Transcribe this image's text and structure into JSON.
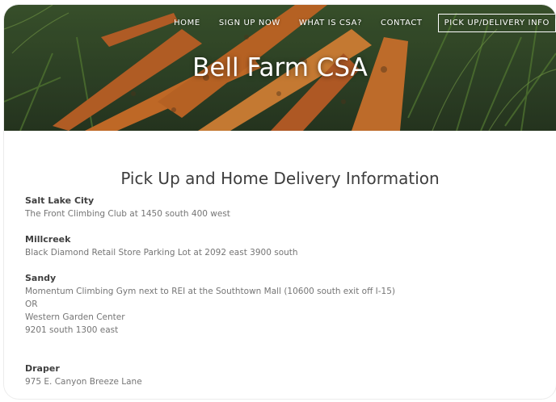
{
  "nav": {
    "items": [
      "HOME",
      "SIGN UP NOW",
      "WHAT IS CSA?",
      "CONTACT"
    ],
    "cta": "PICK UP/DELIVERY INFO"
  },
  "hero": {
    "site_title": "Bell Farm CSA"
  },
  "main": {
    "page_title": "Pick Up and Home Delivery Information",
    "locations": [
      {
        "name": "Salt Lake City",
        "lines": [
          "The Front Climbing Club at 1450 south 400 west"
        ]
      },
      {
        "name": "Millcreek",
        "lines": [
          "Black Diamond Retail Store Parking Lot at 2092 east 3900 south"
        ]
      },
      {
        "name": "Sandy",
        "lines": [
          "Momentum Climbing Gym next to REI at the Southtown Mall (10600 south exit off I-15)",
          "OR",
          "Western Garden Center",
          "9201 south 1300 east"
        ]
      },
      {
        "name": "Draper",
        "lines": [
          "975 E. Canyon Breeze Lane"
        ]
      }
    ]
  },
  "colors": {
    "heading": "#3d3d3d",
    "body_text": "#757575",
    "carrot": "#d9772c"
  }
}
